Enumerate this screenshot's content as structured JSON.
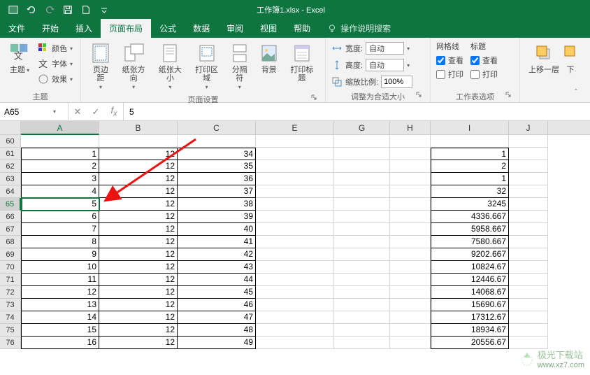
{
  "titlebar": {
    "title": "工作簿1.xlsx  -  Excel"
  },
  "tabs": {
    "file": "文件",
    "home": "开始",
    "insert": "插入",
    "page_layout": "页面布局",
    "formulas": "公式",
    "data": "数据",
    "review": "审阅",
    "view": "视图",
    "help": "帮助",
    "tell_me": "操作说明搜索"
  },
  "ribbon": {
    "themes": {
      "themes_btn": "主题",
      "colors": "颜色",
      "fonts": "字体",
      "effects": "效果",
      "group_label": "主题"
    },
    "page_setup": {
      "margins": "页边距",
      "orientation": "纸张方向",
      "size": "纸张大小",
      "print_area": "打印区域",
      "breaks": "分隔符",
      "background": "背景",
      "print_titles": "打印标题",
      "group_label": "页面设置"
    },
    "scale": {
      "width_lbl": "宽度:",
      "width_val": "自动",
      "height_lbl": "高度:",
      "height_val": "自动",
      "scale_lbl": "缩放比例:",
      "scale_val": "100%",
      "group_label": "调整为合适大小"
    },
    "sheet_options": {
      "gridlines": "网格线",
      "headings": "标题",
      "view": "查看",
      "print": "打印",
      "group_label": "工作表选项"
    },
    "arrange": {
      "bring_forward": "上移一层",
      "send_backward": "下"
    }
  },
  "formula_bar": {
    "name_box": "A65",
    "formula": "5"
  },
  "columns": [
    "A",
    "B",
    "C",
    "E",
    "G",
    "H",
    "I",
    "J"
  ],
  "col_widths": [
    "w-a",
    "w-b",
    "w-c",
    "w-e",
    "w-g",
    "w-h",
    "w-i",
    "w-j"
  ],
  "selected_col_index": 0,
  "selected_row": 65,
  "rows": [
    {
      "n": 60,
      "a": "",
      "b": "",
      "c": "",
      "i": ""
    },
    {
      "n": 61,
      "a": "1",
      "b": "12",
      "c": "34",
      "i": "1"
    },
    {
      "n": 62,
      "a": "2",
      "b": "12",
      "c": "35",
      "i": "2"
    },
    {
      "n": 63,
      "a": "3",
      "b": "12",
      "c": "36",
      "i": "1"
    },
    {
      "n": 64,
      "a": "4",
      "b": "12",
      "c": "37",
      "i": "32"
    },
    {
      "n": 65,
      "a": "5",
      "b": "12",
      "c": "38",
      "i": "3245"
    },
    {
      "n": 66,
      "a": "6",
      "b": "12",
      "c": "39",
      "i": "4336.667"
    },
    {
      "n": 67,
      "a": "7",
      "b": "12",
      "c": "40",
      "i": "5958.667"
    },
    {
      "n": 68,
      "a": "8",
      "b": "12",
      "c": "41",
      "i": "7580.667"
    },
    {
      "n": 69,
      "a": "9",
      "b": "12",
      "c": "42",
      "i": "9202.667"
    },
    {
      "n": 70,
      "a": "10",
      "b": "12",
      "c": "43",
      "i": "10824.67"
    },
    {
      "n": 71,
      "a": "11",
      "b": "12",
      "c": "44",
      "i": "12446.67"
    },
    {
      "n": 72,
      "a": "12",
      "b": "12",
      "c": "45",
      "i": "14068.67"
    },
    {
      "n": 73,
      "a": "13",
      "b": "12",
      "c": "46",
      "i": "15690.67"
    },
    {
      "n": 74,
      "a": "14",
      "b": "12",
      "c": "47",
      "i": "17312.67"
    },
    {
      "n": 75,
      "a": "15",
      "b": "12",
      "c": "48",
      "i": "18934.67"
    },
    {
      "n": 76,
      "a": "16",
      "b": "12",
      "c": "49",
      "i": "20556.67"
    }
  ],
  "watermark": {
    "name": "极光下载站",
    "url": "www.xz7.com"
  }
}
